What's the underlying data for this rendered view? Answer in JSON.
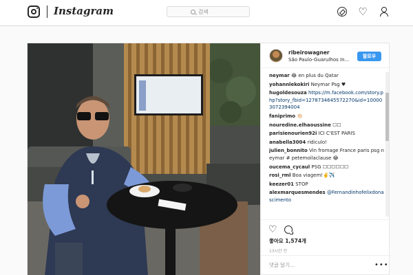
{
  "header": {
    "wordmark": "Instagram",
    "search_placeholder": "검색",
    "icons": [
      "instagram-logo-icon",
      "compass-icon",
      "heart-icon",
      "profile-icon"
    ]
  },
  "post": {
    "author": "ribeirowagner",
    "location": "São Paulo-Guarulhos In...",
    "follow_label": "팔로우",
    "likes": "좋아요 1,574개",
    "time": "13시간 전",
    "comment_placeholder": "댓글 달기...",
    "more": "•••",
    "accent": "#3897f0",
    "photo_description": "Man in glasses and vest holding a wine glass at a round black table in an airport lounge"
  },
  "comments": [
    {
      "user": "neymar",
      "text": "😂 en plus du Qatar"
    },
    {
      "user": "yohannlekokiri",
      "text": "Neymar Psg ♥"
    },
    {
      "user": "hugoldesouza",
      "text": "https://m.facebook.com/story.php?story_fbid=1278734645572270&id=100003072394004"
    },
    {
      "user": "faniprimo",
      "text": "👏🏻"
    },
    {
      "user": "nouredine.elhaoussine",
      "text": "☐☐"
    },
    {
      "user": "parisienourien92i",
      "text": "ICI C'EST PARIS"
    },
    {
      "user": "anabella3004",
      "text": "ridiculo!"
    },
    {
      "user": "julien_bonnito",
      "text": "Vin fromage France paris psg neymar # petemoilaclause 😂"
    },
    {
      "user": "oucema_cycaul",
      "text": "PSG ☐☐☐☐☐☐"
    },
    {
      "user": "rosi_rml",
      "text": "Boa viagem!✌️✈️"
    },
    {
      "user": "keezer01",
      "text": "STOP"
    },
    {
      "user": "alexmarquesmendes",
      "text": "@Fernandinhofelixdonascimento"
    }
  ]
}
